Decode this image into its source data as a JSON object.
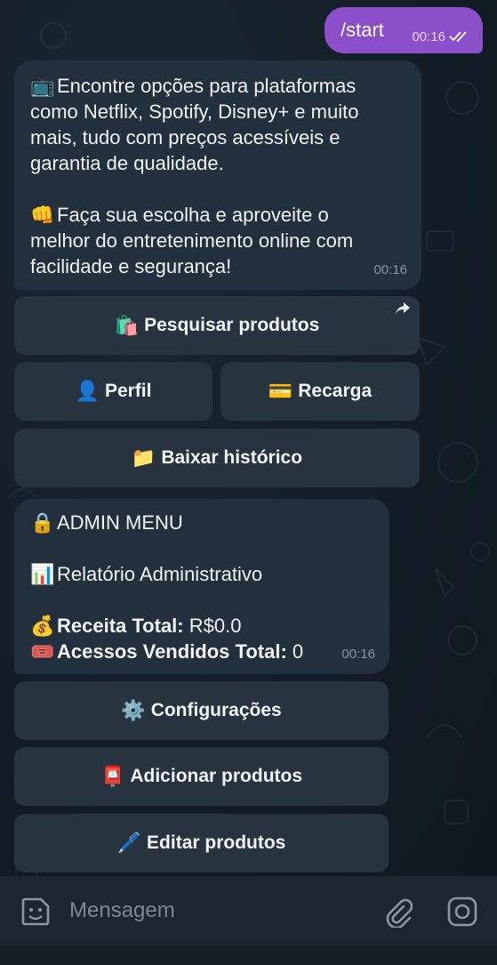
{
  "outgoing": {
    "text": "/start",
    "time": "00:16"
  },
  "welcome": {
    "icon": "television-icon",
    "lines_a": [
      "Encontre opções para plataformas",
      "como Netflix, Spotify, Disney+ e muito",
      "mais, tudo com preços acessíveis e",
      "garantia de qualidade."
    ],
    "lines_b": [
      "Faça sua escolha e aproveite o",
      "melhor do entretenimento online com",
      "facilidade e segurança!"
    ],
    "time": "00:16"
  },
  "user_menu": {
    "search": {
      "icon": "shopping-bag-icon",
      "label": "Pesquisar produtos"
    },
    "profile": {
      "icon": "person-icon",
      "label": "Perfil"
    },
    "recharge": {
      "icon": "card-icon",
      "label": "Recarga"
    },
    "history": {
      "icon": "folder-icon",
      "label": "Baixar histórico"
    }
  },
  "admin": {
    "title": "ADMIN MENU",
    "report_title": "Relatório Administrativo",
    "revenue_label": "Receita Total:",
    "revenue_value": "R$0.0",
    "sold_label": "Acessos Vendidos Total:",
    "sold_value": "0",
    "time": "00:16"
  },
  "admin_menu": {
    "settings": {
      "icon": "gear-icon",
      "label": "Configurações"
    },
    "add_products": {
      "icon": "mailbox-icon",
      "label": "Adicionar produtos"
    },
    "edit_products": {
      "icon": "pen-icon",
      "label": "Editar produtos"
    }
  },
  "composer": {
    "placeholder": "Mensagem"
  },
  "colors": {
    "outgoing_bubble": "#8b4fc9",
    "incoming_bubble": "#222f3c",
    "button": "#27333f",
    "background": "#0e1621"
  }
}
